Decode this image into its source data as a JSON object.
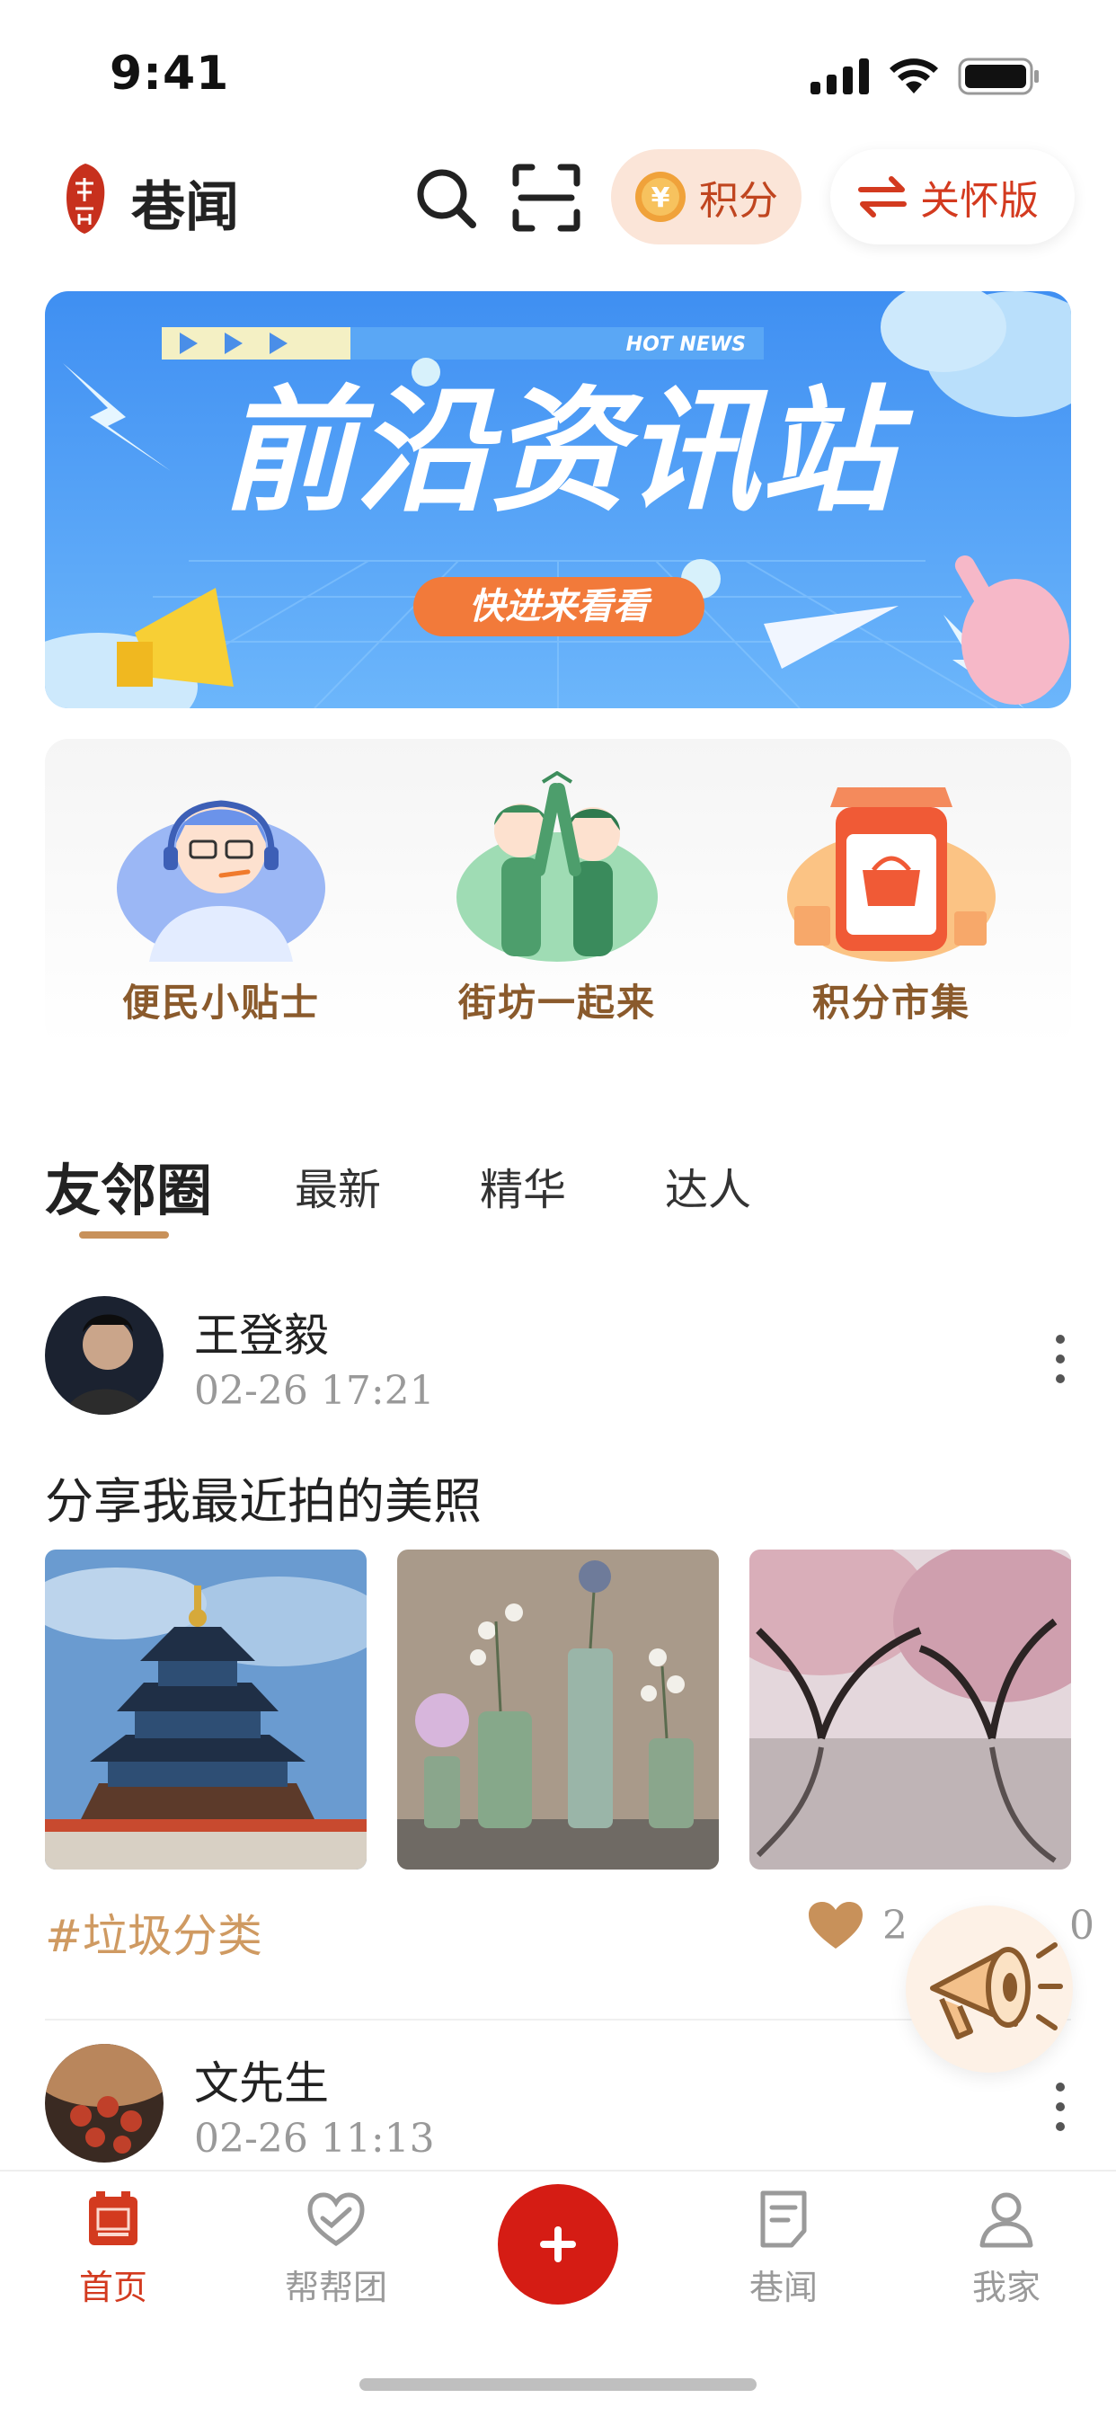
{
  "status_bar": {
    "time": "9:41"
  },
  "header": {
    "logo_text": "巷闻",
    "title": "巷闻",
    "points_label": "积分",
    "care_label": "关怀版"
  },
  "banner": {
    "tag": "HOT NEWS",
    "headline": "前沿资讯站",
    "button": "快进来看看"
  },
  "quick_actions": [
    {
      "label": "便民小贴士"
    },
    {
      "label": "街坊一起来"
    },
    {
      "label": "积分市集"
    }
  ],
  "tabs": [
    {
      "label": "友邻圈"
    },
    {
      "label": "最新"
    },
    {
      "label": "精华"
    },
    {
      "label": "达人"
    }
  ],
  "posts": [
    {
      "author": "王登毅",
      "time": "02-26 17:21",
      "text": "分享我最近拍的美照",
      "tag": "#垃圾分类",
      "likes": "2",
      "comments": "0"
    },
    {
      "author": "文先生",
      "time": "02-26 11:13"
    }
  ],
  "tabbar": {
    "items": [
      {
        "label": "首页"
      },
      {
        "label": "帮帮团"
      },
      {
        "label": "巷闻"
      },
      {
        "label": "我家"
      }
    ]
  },
  "colors": {
    "accent_red": "#d33a1f",
    "brown": "#8a5a2c",
    "tag_gold": "#cf9a62"
  }
}
